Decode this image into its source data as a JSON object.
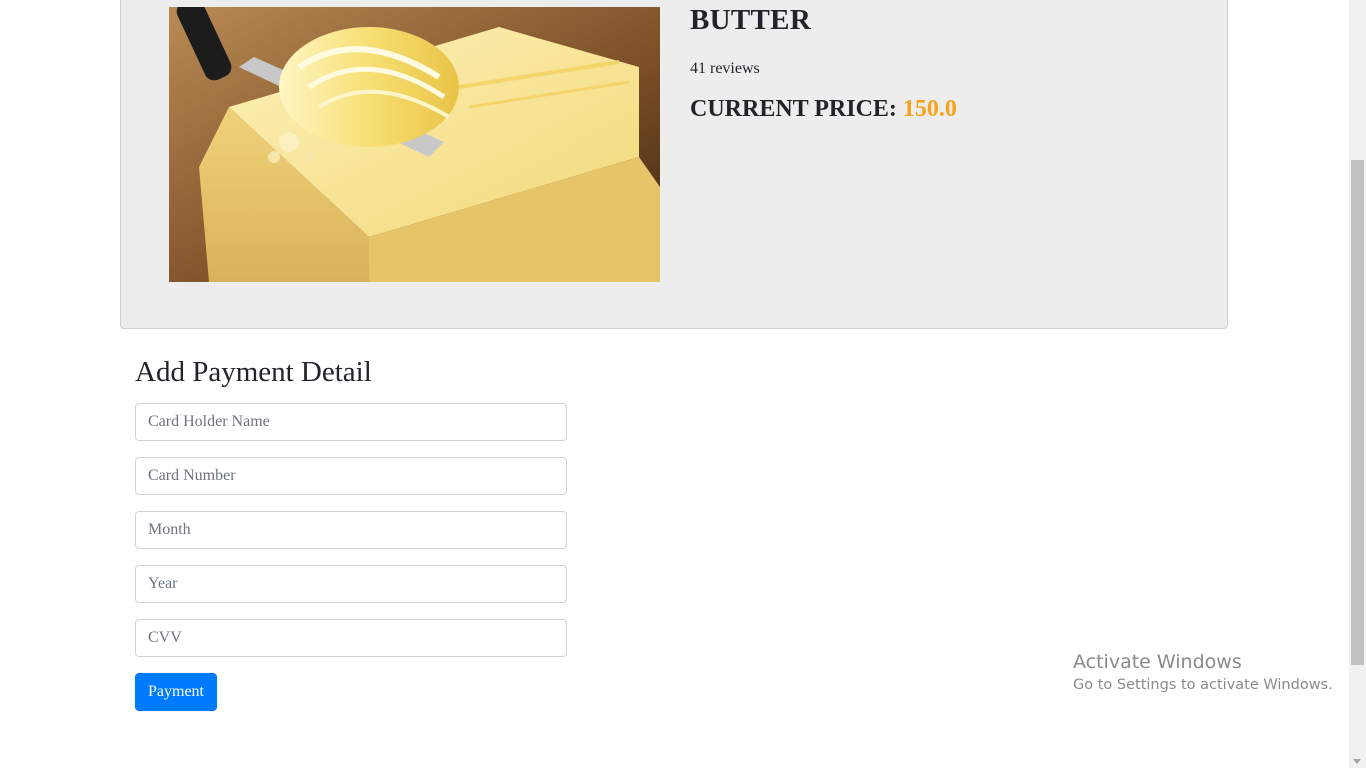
{
  "product": {
    "title": "BUTTER",
    "reviews": "41 reviews",
    "price_label": "CURRENT PRICE:",
    "price_value": "150.0",
    "image_alt": "Butter block being curled with a knife"
  },
  "payment": {
    "heading": "Add Payment Detail",
    "fields": {
      "card_holder": {
        "placeholder": "Card Holder Name",
        "value": ""
      },
      "card_number": {
        "placeholder": "Card Number",
        "value": ""
      },
      "month": {
        "placeholder": "Month",
        "value": ""
      },
      "year": {
        "placeholder": "Year",
        "value": ""
      },
      "cvv": {
        "placeholder": "CVV",
        "value": ""
      }
    },
    "button_label": "Payment"
  },
  "watermark": {
    "title": "Activate Windows",
    "subtitle": "Go to Settings to activate Windows."
  },
  "colors": {
    "accent": "#f7a21b",
    "primary_button": "#007bff",
    "card_background": "#ededed"
  }
}
